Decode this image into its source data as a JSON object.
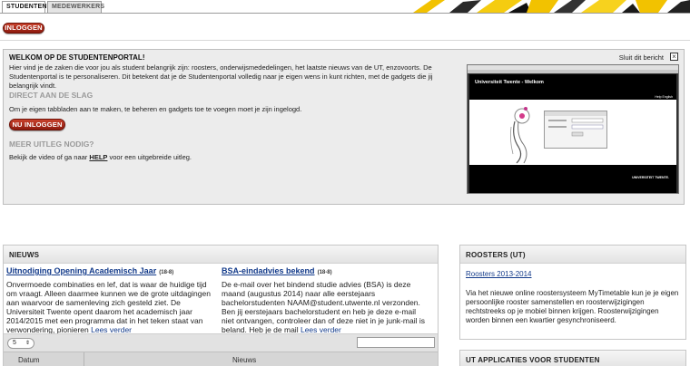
{
  "tabs": [
    {
      "label": "STUDENTEN",
      "active": true
    },
    {
      "label": "MEDEWERKERS",
      "active": false
    }
  ],
  "login_button": "INLOGGEN",
  "welcome": {
    "title": "WELKOM OP DE STUDENTENPORTAL!",
    "close_label": "Sluit dit bericht",
    "close_icon": "close-icon",
    "intro": "Hier vind je de zaken die voor jou als student belangrijk zijn: roosters, onderwijsmededelingen, het laatste nieuws van de UT, enzovoorts. De Studentenportal is te personaliseren. Dit betekent dat je de Studentenportal volledig naar je eigen wens in kunt richten, met de gadgets die jij belangrijk vindt.",
    "section1_title": "DIRECT AAN DE SLAG",
    "section1_text": "Om je eigen tabbladen aan te maken, te beheren en gadgets toe te voegen moet je zijn ingelogd.",
    "section1_button": "NU INLOGGEN",
    "section2_title": "MEER UITLEG NODIG?",
    "section2_text_before": "Bekijk de video of ga naar",
    "section2_link": "HELP",
    "section2_text_after": "voor een uitgebreide uitleg.",
    "thumbnail": {
      "header_title": "Universiteit Twente - Welkom",
      "nav": "Help  English",
      "footer": "UNIVERSITEIT TWENTE."
    }
  },
  "news": {
    "title": "NIEUWS",
    "items": [
      {
        "headline": "Uitnodiging Opening Academisch Jaar",
        "date": "(18-8)",
        "body": "Onvermoede combinaties en lef, dat is waar de huidige tijd om vraagt. Alleen daarmee kunnen we de grote uitdagingen aan waarvoor de samenleving zich gesteld ziet. De Universiteit Twente opent daarom het academisch jaar 2014/2015 met een programma dat in het teken staat van verwondering, pionieren",
        "more": "Lees verder"
      },
      {
        "headline": "BSA-eindadvies bekend",
        "date": "(18-8)",
        "body": "De e-mail over het bindend studie advies (BSA) is deze maand (augustus 2014) naar alle eerstejaars bachelorstudenten NAAM@student.utwente.nl verzonden. Ben jij eerstejaars bachelorstudent en heb je deze e-mail niet ontvangen, controleer dan of deze niet in je junk-mail is beland. Heb je de mail",
        "more": "Lees verder"
      }
    ],
    "page_size": "5",
    "columns": [
      "Datum",
      "Nieuws"
    ]
  },
  "roosters": {
    "title": "ROOSTERS (UT)",
    "link": "Roosters 2013-2014",
    "text": "Via het nieuwe online roostersysteem MyTimetable kun je je eigen persoonlijke rooster samenstellen en roosterwijzigingen rechtstreeks op je mobiel binnen krijgen. Roosterwijzigingen worden binnen een kwartier gesynchroniseerd."
  },
  "apps": {
    "title": "UT APPLICATIES VOOR STUDENTEN"
  },
  "colors": {
    "accent_red": "#a8261a",
    "link_blue": "#123a8a",
    "banner_yellow": "#f2c200"
  }
}
